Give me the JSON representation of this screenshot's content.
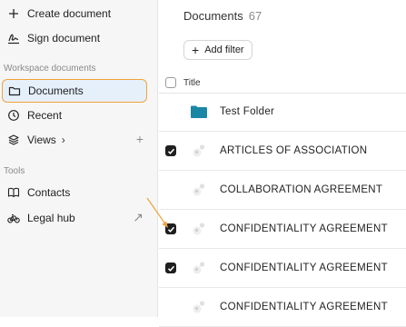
{
  "sidebar": {
    "top_items": [
      {
        "label": "Create document",
        "icon": "plus-icon"
      },
      {
        "label": "Sign document",
        "icon": "signature-icon"
      }
    ],
    "workspace_section": "Workspace documents",
    "workspace_items": [
      {
        "label": "Documents",
        "icon": "folder-icon",
        "active": true
      },
      {
        "label": "Recent",
        "icon": "clock-icon"
      },
      {
        "label": "Views",
        "icon": "layers-icon",
        "chevron": "›",
        "trailing": "+"
      }
    ],
    "tools_section": "Tools",
    "tools_items": [
      {
        "label": "Contacts",
        "icon": "book-icon"
      },
      {
        "label": "Legal hub",
        "icon": "bicycle-icon",
        "trailing": "↗"
      }
    ]
  },
  "main": {
    "title": "Documents",
    "count": "67",
    "add_filter_label": "Add filter",
    "add_filter_plus": "+",
    "column_title": "Title",
    "rows": [
      {
        "name": "Test Folder",
        "type": "folder",
        "checked": false
      },
      {
        "name": "ARTICLES OF ASSOCIATION",
        "type": "document",
        "checked": true
      },
      {
        "name": "COLLABORATION AGREEMENT",
        "type": "document",
        "checked": false
      },
      {
        "name": "CONFIDENTIALITY AGREEMENT",
        "type": "document",
        "checked": true
      },
      {
        "name": "CONFIDENTIALITY AGREEMENT",
        "type": "document",
        "checked": true
      },
      {
        "name": "CONFIDENTIALITY AGREEMENT",
        "type": "document",
        "checked": false
      }
    ]
  },
  "colors": {
    "active_bg": "#e6f0fb",
    "active_border": "#f1a33a",
    "folder_teal": "#1b87a6",
    "annotation_arrow": "#f1a33a"
  }
}
